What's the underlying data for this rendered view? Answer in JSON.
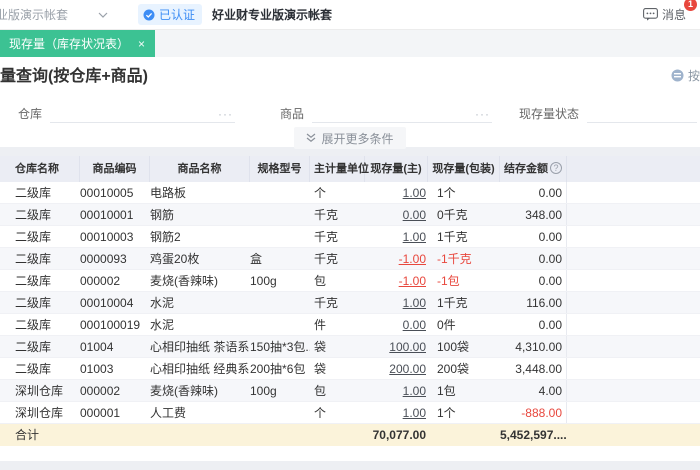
{
  "topbar": {
    "account_fragment": "业版演示帐套",
    "verified_badge": "已认证",
    "company_name": "好业财专业版演示帐套",
    "message_label": "消息",
    "message_badge_count": "1"
  },
  "tabbar": {
    "active_tab": "现存量（库存状况表）",
    "close_glyph": "×"
  },
  "page": {
    "title": "量查询(按仓库+商品)",
    "template_link": "按模"
  },
  "filters": {
    "warehouse_label": "仓库",
    "product_label": "商品",
    "status_label": "现存量状态",
    "picker_ellipsis": "···",
    "expand_button": "展开更多条件"
  },
  "table": {
    "columns": [
      "仓库名称",
      "商品编码",
      "商品名称",
      "规格型号",
      "主计量单位",
      "现存量(主)",
      "现存量(包装)",
      "结存金额"
    ],
    "amount_info_glyph": "?",
    "rows": [
      {
        "warehouse": "二级库",
        "code": "00010005",
        "name": "电路板",
        "spec": "",
        "unit": "个",
        "qty_main": "1.00",
        "qty_pkg": "1个",
        "amount": "0.00",
        "qty_negative": false,
        "amount_negative": false
      },
      {
        "warehouse": "二级库",
        "code": "00010001",
        "name": "钢筋",
        "spec": "",
        "unit": "千克",
        "qty_main": "0.00",
        "qty_pkg": "0千克",
        "amount": "348.00",
        "qty_negative": false,
        "amount_negative": false
      },
      {
        "warehouse": "二级库",
        "code": "00010003",
        "name": "钢筋2",
        "spec": "",
        "unit": "千克",
        "qty_main": "1.00",
        "qty_pkg": "1千克",
        "amount": "0.00",
        "qty_negative": false,
        "amount_negative": false
      },
      {
        "warehouse": "二级库",
        "code": "0000093",
        "name": "鸡蛋20枚",
        "spec": "盒",
        "unit": "千克",
        "qty_main": "-1.00",
        "qty_pkg": "-1千克",
        "amount": "0.00",
        "qty_negative": true,
        "amount_negative": false
      },
      {
        "warehouse": "二级库",
        "code": "000002",
        "name": "麦烧(香辣味)",
        "spec": "100g",
        "unit": "包",
        "qty_main": "-1.00",
        "qty_pkg": "-1包",
        "amount": "0.00",
        "qty_negative": true,
        "amount_negative": false
      },
      {
        "warehouse": "二级库",
        "code": "00010004",
        "name": "水泥",
        "spec": "",
        "unit": "千克",
        "qty_main": "1.00",
        "qty_pkg": "1千克",
        "amount": "116.00",
        "qty_negative": false,
        "amount_negative": false
      },
      {
        "warehouse": "二级库",
        "code": "000100019",
        "name": "水泥",
        "spec": "",
        "unit": "件",
        "qty_main": "0.00",
        "qty_pkg": "0件",
        "amount": "0.00",
        "qty_negative": false,
        "amount_negative": false
      },
      {
        "warehouse": "二级库",
        "code": "01004",
        "name": "心相印抽纸 茶语系列 ...",
        "spec": "150抽*3包...",
        "unit": "袋",
        "qty_main": "100.00",
        "qty_pkg": "100袋",
        "amount": "4,310.00",
        "qty_negative": false,
        "amount_negative": false
      },
      {
        "warehouse": "二级库",
        "code": "01003",
        "name": "心相印抽纸 经典系列",
        "spec": "200抽*6包",
        "unit": "袋",
        "qty_main": "200.00",
        "qty_pkg": "200袋",
        "amount": "3,448.00",
        "qty_negative": false,
        "amount_negative": false
      },
      {
        "warehouse": "深圳仓库",
        "code": "000002",
        "name": "麦烧(香辣味)",
        "spec": "100g",
        "unit": "包",
        "qty_main": "1.00",
        "qty_pkg": "1包",
        "amount": "4.00",
        "qty_negative": false,
        "amount_negative": false
      },
      {
        "warehouse": "深圳仓库",
        "code": "000001",
        "name": "人工费",
        "spec": "",
        "unit": "个",
        "qty_main": "1.00",
        "qty_pkg": "1个",
        "amount": "-888.00",
        "qty_negative": false,
        "amount_negative": true
      }
    ],
    "total": {
      "label": "合计",
      "qty_main_total": "70,077.00",
      "amount_total": "5,452,597...."
    }
  },
  "colors": {
    "accent_green": "#3cc293",
    "accent_blue": "#3d8df5",
    "negative_red": "#e8473d",
    "total_row_bg": "#fbf3da",
    "page_bg": "#edeff3",
    "header_bg": "#ebedf4"
  }
}
